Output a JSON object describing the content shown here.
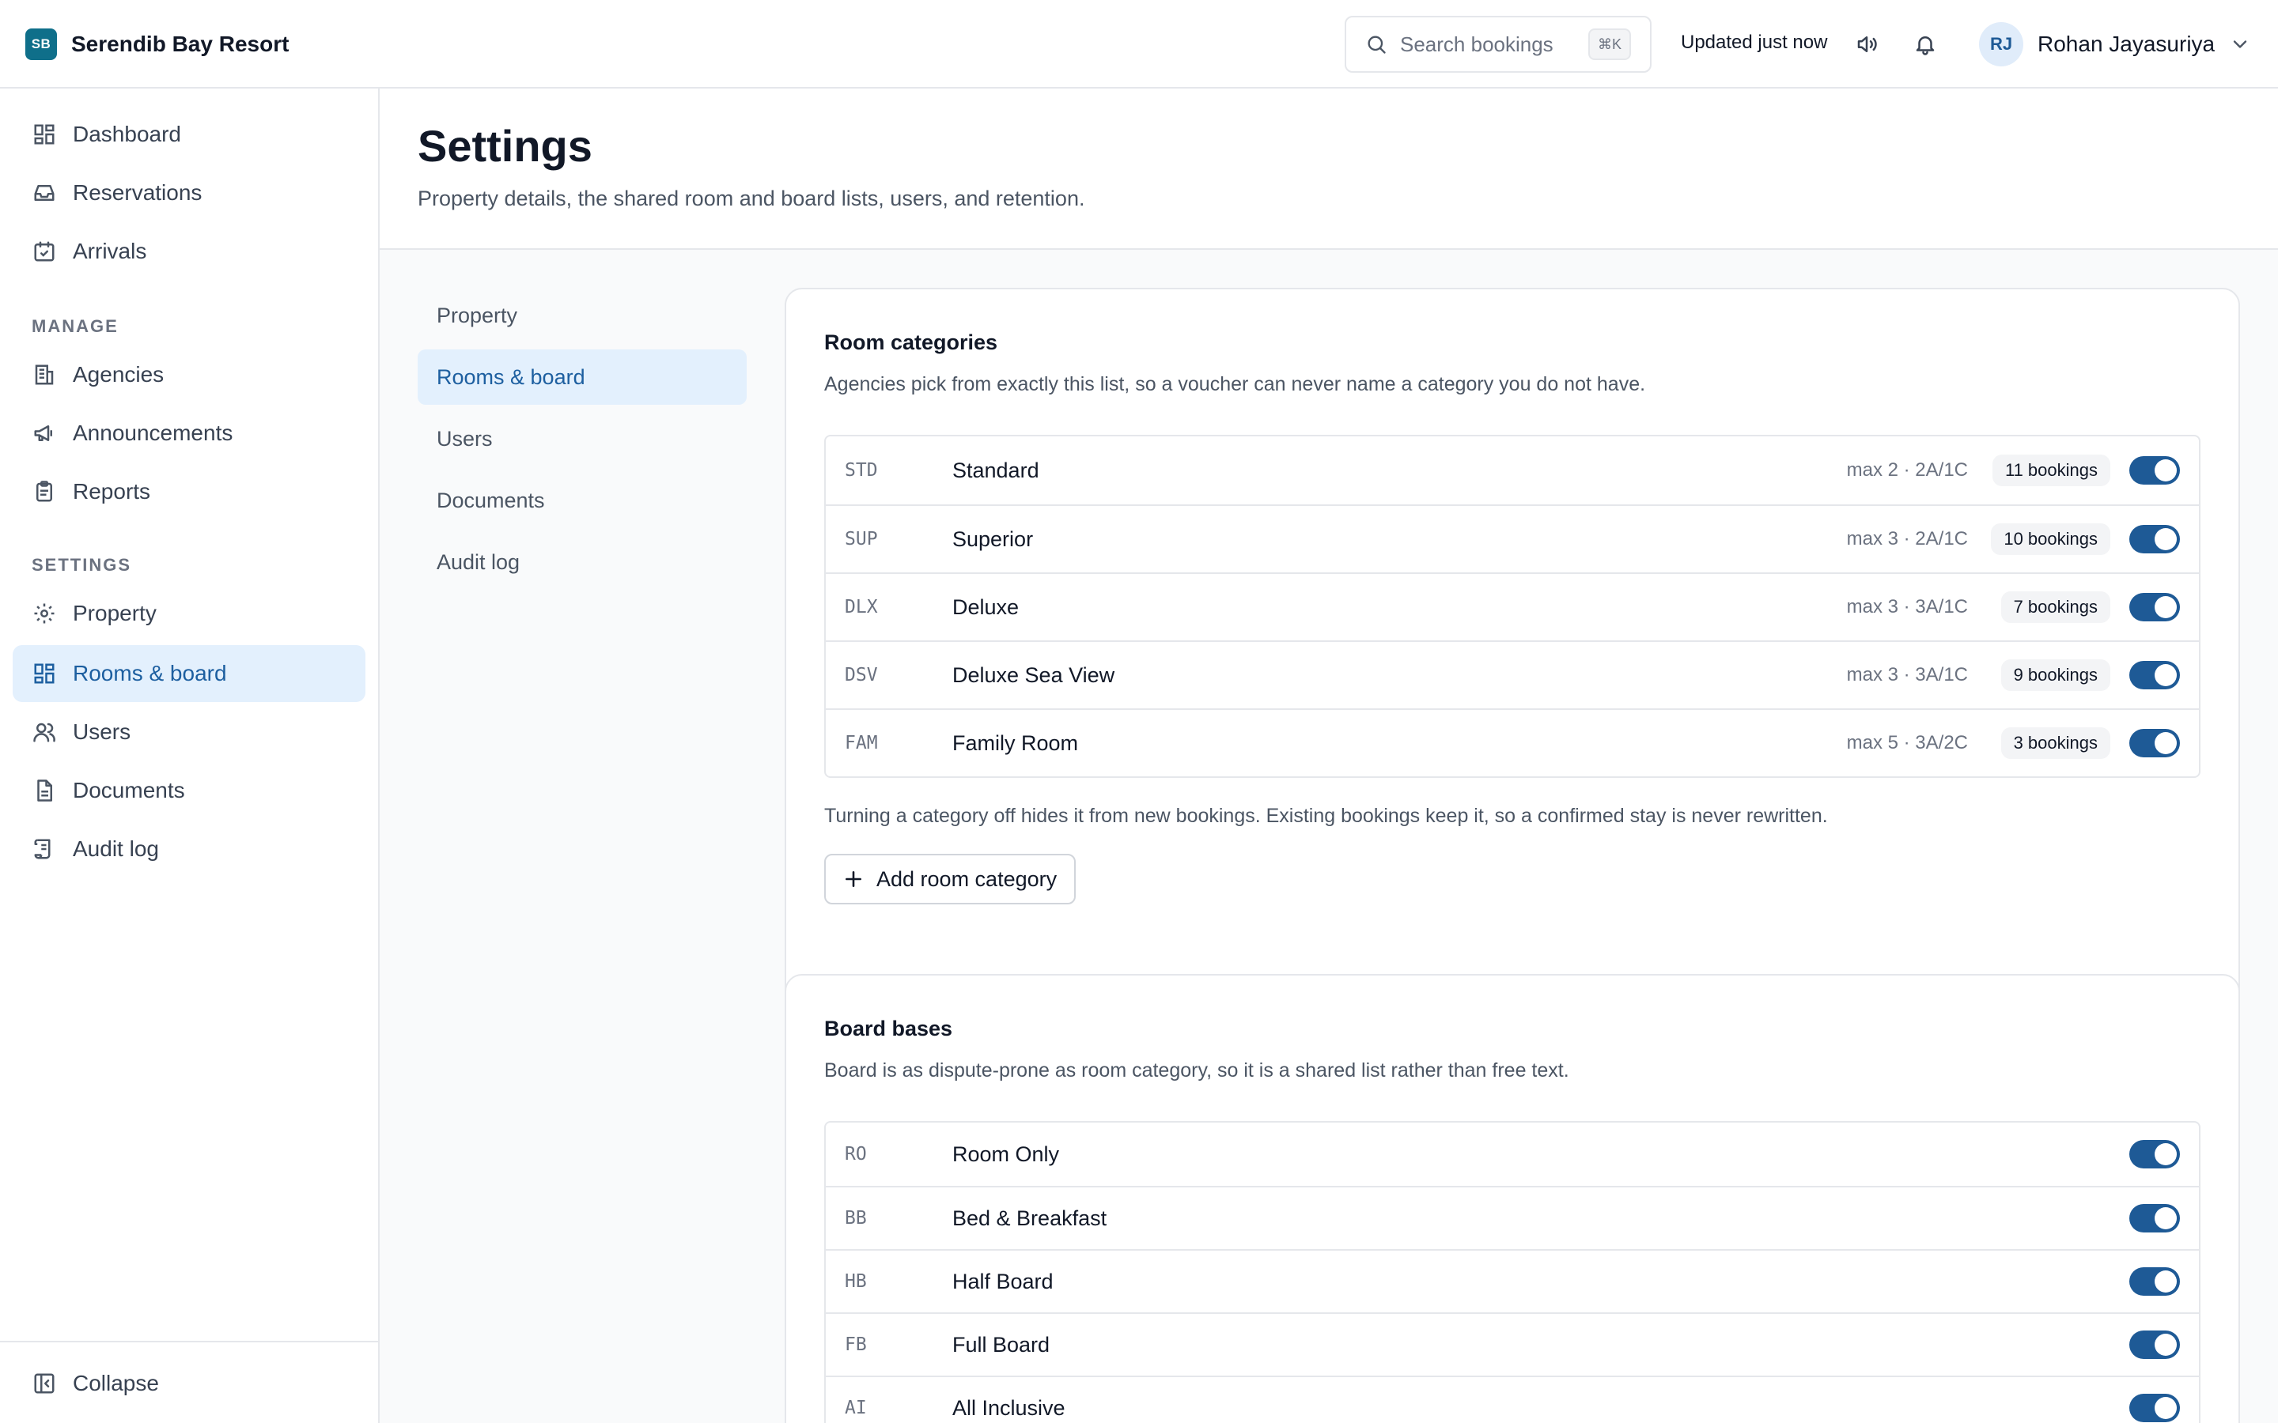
{
  "header": {
    "brand_initials": "SB",
    "brand_name": "Serendib Bay Resort",
    "search_placeholder": "Search bookings",
    "search_shortcut": "⌘K",
    "status": "Updated just now",
    "user_initials": "RJ",
    "user_name": "Rohan Jayasuriya"
  },
  "sidebar": {
    "primary": [
      {
        "label": "Dashboard",
        "icon": "dashboard-icon"
      },
      {
        "label": "Reservations",
        "icon": "inbox-icon"
      },
      {
        "label": "Arrivals",
        "icon": "calendar-check-icon"
      }
    ],
    "manage_heading": "MANAGE",
    "manage": [
      {
        "label": "Agencies",
        "icon": "building-icon"
      },
      {
        "label": "Announcements",
        "icon": "megaphone-icon"
      },
      {
        "label": "Reports",
        "icon": "clipboard-icon"
      }
    ],
    "settings_heading": "SETTINGS",
    "settings": [
      {
        "label": "Property",
        "icon": "gear-icon"
      },
      {
        "label": "Rooms & board",
        "icon": "grid-icon",
        "active": true
      },
      {
        "label": "Users",
        "icon": "users-icon"
      },
      {
        "label": "Documents",
        "icon": "document-icon"
      },
      {
        "label": "Audit log",
        "icon": "scroll-icon"
      }
    ],
    "collapse_label": "Collapse"
  },
  "page": {
    "title": "Settings",
    "subtitle": "Property details, the shared room and board lists, users, and retention."
  },
  "subnav": {
    "items": [
      "Property",
      "Rooms & board",
      "Users",
      "Documents",
      "Audit log"
    ],
    "active_index": 1
  },
  "room_categories": {
    "title": "Room categories",
    "description": "Agencies pick from exactly this list, so a voucher can never name a category you do not have.",
    "rows": [
      {
        "code": "STD",
        "name": "Standard",
        "capacity": "max 2 · 2A/1C",
        "bookings": "11 bookings",
        "enabled": true
      },
      {
        "code": "SUP",
        "name": "Superior",
        "capacity": "max 3 · 2A/1C",
        "bookings": "10 bookings",
        "enabled": true
      },
      {
        "code": "DLX",
        "name": "Deluxe",
        "capacity": "max 3 · 3A/1C",
        "bookings": "7 bookings",
        "enabled": true
      },
      {
        "code": "DSV",
        "name": "Deluxe Sea View",
        "capacity": "max 3 · 3A/1C",
        "bookings": "9 bookings",
        "enabled": true
      },
      {
        "code": "FAM",
        "name": "Family Room",
        "capacity": "max 5 · 3A/2C",
        "bookings": "3 bookings",
        "enabled": true
      }
    ],
    "note": "Turning a category off hides it from new bookings. Existing bookings keep it, so a confirmed stay is never rewritten.",
    "add_label": "Add room category"
  },
  "board_bases": {
    "title": "Board bases",
    "description": "Board is as dispute-prone as room category, so it is a shared list rather than free text.",
    "rows": [
      {
        "code": "RO",
        "name": "Room Only",
        "enabled": true
      },
      {
        "code": "BB",
        "name": "Bed & Breakfast",
        "enabled": true
      },
      {
        "code": "HB",
        "name": "Half Board",
        "enabled": true
      },
      {
        "code": "FB",
        "name": "Full Board",
        "enabled": true
      },
      {
        "code": "AI",
        "name": "All Inclusive",
        "enabled": true
      }
    ]
  },
  "colors": {
    "brand": "#0f6f8a",
    "accent": "#1e5a96",
    "active_bg": "#e3f0fd"
  }
}
